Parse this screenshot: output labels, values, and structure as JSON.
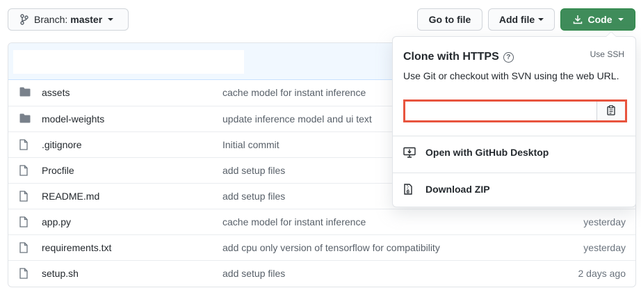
{
  "toolbar": {
    "branch_label": "Branch:",
    "branch_name": "master",
    "goto_file": "Go to file",
    "add_file": "Add file",
    "code": "Code"
  },
  "files": [
    {
      "name": "assets",
      "type": "folder",
      "message": "cache model for instant inference",
      "age": ""
    },
    {
      "name": "model-weights",
      "type": "folder",
      "message": "update inference model and ui text",
      "age": ""
    },
    {
      "name": ".gitignore",
      "type": "file",
      "message": "Initial commit",
      "age": ""
    },
    {
      "name": "Procfile",
      "type": "file",
      "message": "add setup files",
      "age": ""
    },
    {
      "name": "README.md",
      "type": "file",
      "message": "add setup files",
      "age": ""
    },
    {
      "name": "app.py",
      "type": "file",
      "message": "cache model for instant inference",
      "age": "yesterday"
    },
    {
      "name": "requirements.txt",
      "type": "file",
      "message": "add cpu only version of tensorflow for compatibility",
      "age": "yesterday"
    },
    {
      "name": "setup.sh",
      "type": "file",
      "message": "add setup files",
      "age": "2 days ago"
    }
  ],
  "clone": {
    "title": "Clone with HTTPS",
    "help": "?",
    "use_ssh": "Use SSH",
    "description": "Use Git or checkout with SVN using the web URL.",
    "url_value": "",
    "open_desktop": "Open with GitHub Desktop",
    "download_zip": "Download ZIP"
  },
  "colors": {
    "code_button": "#3f8c5a",
    "highlight_border": "#e8543e",
    "header_bg": "#f1f8ff"
  },
  "icons": {
    "branch": "branch-icon",
    "download": "download-icon",
    "folder": "folder-icon",
    "file": "file-icon",
    "clipboard": "clipboard-icon",
    "desktop": "desktop-download-icon",
    "zip": "file-zip-icon"
  }
}
